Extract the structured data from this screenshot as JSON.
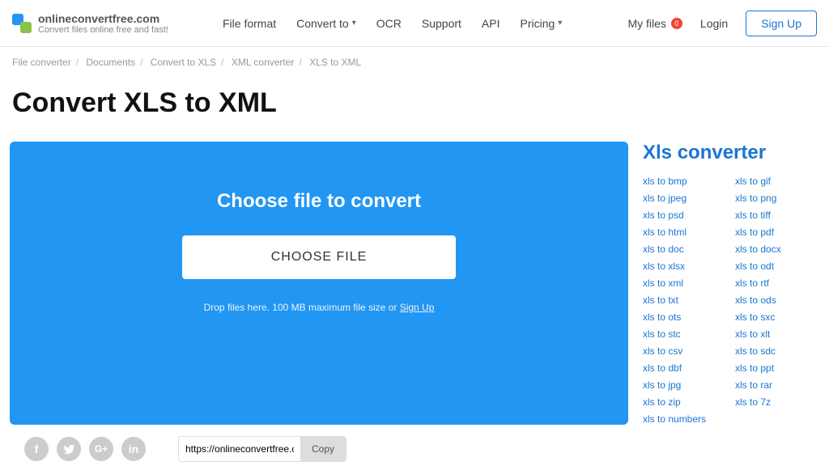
{
  "header": {
    "brand": "onlineconvertfree.com",
    "tagline": "Convert files online free and fast!",
    "nav": [
      "File format",
      "Convert to",
      "OCR",
      "Support",
      "API",
      "Pricing"
    ],
    "myfiles": "My files",
    "badge": "0",
    "login": "Login",
    "signup": "Sign Up"
  },
  "breadcrumb": [
    "File converter",
    "Documents",
    "Convert to XLS",
    "XML converter",
    "XLS to XML"
  ],
  "page_title": "Convert XLS to XML",
  "upload": {
    "title": "Choose file to convert",
    "button": "CHOOSE FILE",
    "hint_pre": "Drop files here. 100 MB maximum file size or ",
    "hint_link": "Sign Up"
  },
  "sidebar": {
    "title": "Xls converter",
    "col1": [
      "xls to bmp",
      "xls to jpeg",
      "xls to psd",
      "xls to html",
      "xls to doc",
      "xls to xlsx",
      "xls to xml",
      "xls to txt",
      "xls to ots",
      "xls to stc",
      "xls to csv",
      "xls to dbf",
      "xls to jpg",
      "xls to zip",
      "xls to numbers"
    ],
    "col2": [
      "xls to gif",
      "xls to png",
      "xls to tiff",
      "xls to pdf",
      "xls to docx",
      "xls to odt",
      "xls to rtf",
      "xls to ods",
      "xls to sxc",
      "xls to xlt",
      "xls to sdc",
      "xls to ppt",
      "xls to rar",
      "xls to 7z"
    ]
  },
  "footer": {
    "url": "https://onlineconvertfree.c",
    "copy": "Copy"
  }
}
